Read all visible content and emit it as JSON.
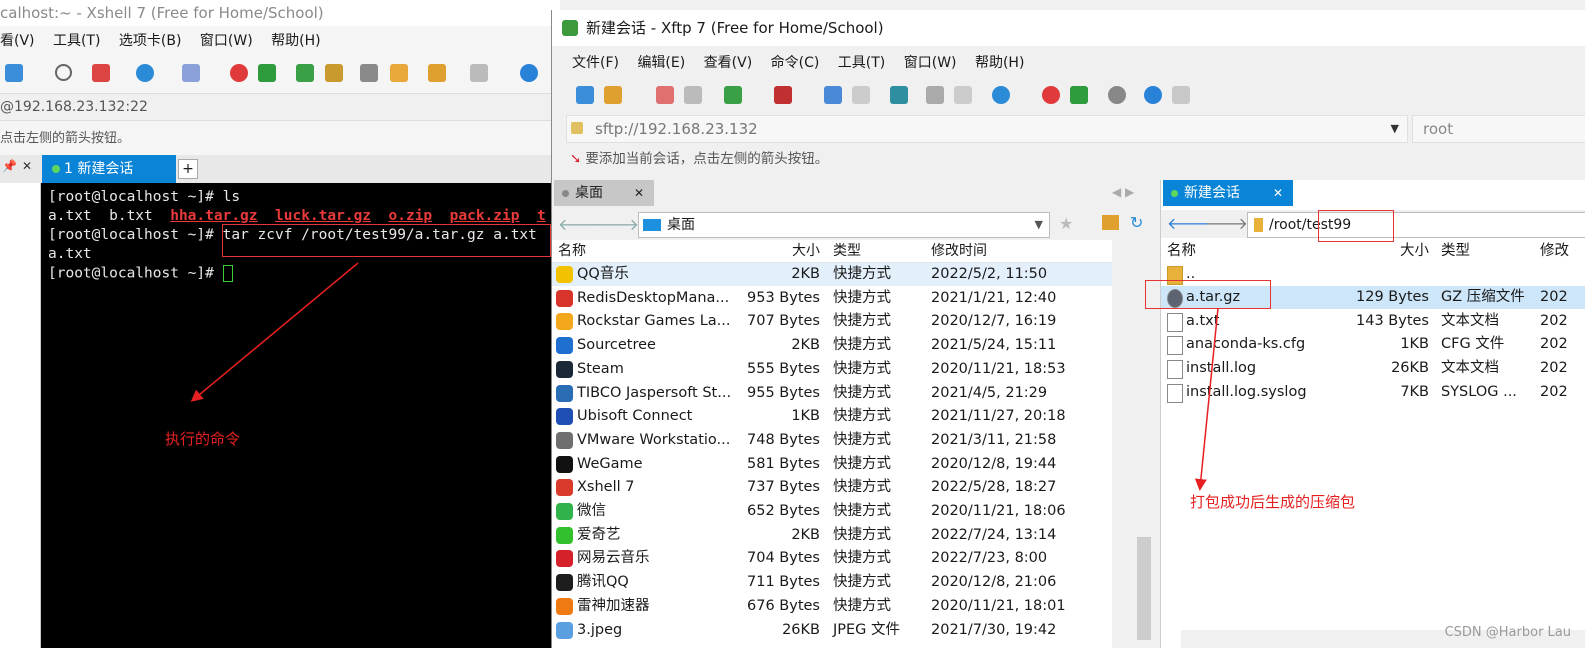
{
  "xshell": {
    "title": "calhost:~ - Xshell 7 (Free for Home/School)",
    "menu": [
      "看(V)",
      "工具(T)",
      "选项卡(B)",
      "窗口(W)",
      "帮助(H)"
    ],
    "address": "@192.168.23.132:22",
    "hint": "点击左侧的箭头按钮。",
    "tab_label": "1 新建会话",
    "tab_plus": "+",
    "terminal": {
      "line1_prompt": "[root@localhost ~]# ",
      "line1_cmd": "ls",
      "line2_plain": "a.txt  b.txt  ",
      "line2_red": [
        "hha.tar.gz",
        "luck.tar.gz",
        "o.zip",
        "pack.zip",
        "t"
      ],
      "line3_prompt": "[root@localhost ~]# ",
      "line3_cmd": "tar zcvf /root/test99/a.tar.gz a.txt",
      "line4": "a.txt",
      "line5_prompt": "[root@localhost ~]# "
    }
  },
  "xftp": {
    "title": "新建会话 - Xftp 7 (Free for Home/School)",
    "menu": [
      "文件(F)",
      "编辑(E)",
      "查看(V)",
      "命令(C)",
      "工具(T)",
      "窗口(W)",
      "帮助(H)"
    ],
    "address": "sftp://192.168.23.132",
    "user": "root",
    "hint": "要添加当前会话，点击左侧的箭头按钮。",
    "left_pane": {
      "tab": "桌面",
      "path": "桌面",
      "headers": {
        "name": "名称",
        "size": "大小",
        "type": "类型",
        "date": "修改时间"
      },
      "rows": [
        {
          "name": "QQ音乐",
          "size": "2KB",
          "type": "快捷方式",
          "date": "2022/5/2, 11:50",
          "icon_color": "#f2c200"
        },
        {
          "name": "RedisDesktopMana...",
          "size": "953 Bytes",
          "type": "快捷方式",
          "date": "2021/1/21, 12:40",
          "icon_color": "#d9342b"
        },
        {
          "name": "Rockstar Games La...",
          "size": "707 Bytes",
          "type": "快捷方式",
          "date": "2020/12/7, 16:19",
          "icon_color": "#f3a81c"
        },
        {
          "name": "Sourcetree",
          "size": "2KB",
          "type": "快捷方式",
          "date": "2021/5/24, 15:11",
          "icon_color": "#1f6fd1"
        },
        {
          "name": "Steam",
          "size": "555 Bytes",
          "type": "快捷方式",
          "date": "2020/11/21, 18:53",
          "icon_color": "#1b2838"
        },
        {
          "name": "TIBCO Jaspersoft St...",
          "size": "955 Bytes",
          "type": "快捷方式",
          "date": "2021/4/5, 21:29",
          "icon_color": "#2a6db5"
        },
        {
          "name": "Ubisoft Connect",
          "size": "1KB",
          "type": "快捷方式",
          "date": "2021/11/27, 20:18",
          "icon_color": "#1f4fb5"
        },
        {
          "name": "VMware Workstatio...",
          "size": "748 Bytes",
          "type": "快捷方式",
          "date": "2021/3/11, 21:58",
          "icon_color": "#6f6f6f"
        },
        {
          "name": "WeGame",
          "size": "581 Bytes",
          "type": "快捷方式",
          "date": "2020/12/8, 19:44",
          "icon_color": "#111111"
        },
        {
          "name": "Xshell 7",
          "size": "737 Bytes",
          "type": "快捷方式",
          "date": "2022/5/28, 18:27",
          "icon_color": "#d93a2b"
        },
        {
          "name": "微信",
          "size": "652 Bytes",
          "type": "快捷方式",
          "date": "2020/11/21, 18:06",
          "icon_color": "#2fb34a"
        },
        {
          "name": "爱奇艺",
          "size": "2KB",
          "type": "快捷方式",
          "date": "2022/7/24, 13:14",
          "icon_color": "#32c12c"
        },
        {
          "name": "网易云音乐",
          "size": "704 Bytes",
          "type": "快捷方式",
          "date": "2022/7/23, 8:00",
          "icon_color": "#d6202a"
        },
        {
          "name": "腾讯QQ",
          "size": "711 Bytes",
          "type": "快捷方式",
          "date": "2020/12/8, 21:06",
          "icon_color": "#1d1d1d"
        },
        {
          "name": "雷神加速器",
          "size": "676 Bytes",
          "type": "快捷方式",
          "date": "2020/11/21, 18:01",
          "icon_color": "#f07a12"
        },
        {
          "name": "3.jpeg",
          "size": "26KB",
          "type": "JPEG 文件",
          "date": "2021/7/30, 19:42",
          "icon_color": "#5aa0e0"
        }
      ]
    },
    "right_pane": {
      "tab": "新建会话",
      "path": "/root/test99",
      "headers": {
        "name": "名称",
        "size": "大小",
        "type": "类型",
        "date": "修改"
      },
      "parent": "..",
      "rows": [
        {
          "name": "a.tar.gz",
          "size": "129 Bytes",
          "type": "GZ 压缩文件",
          "date": "202"
        },
        {
          "name": "a.txt",
          "size": "143 Bytes",
          "type": "文本文档",
          "date": "202"
        },
        {
          "name": "anaconda-ks.cfg",
          "size": "1KB",
          "type": "CFG 文件",
          "date": "202"
        },
        {
          "name": "install.log",
          "size": "26KB",
          "type": "文本文档",
          "date": "202"
        },
        {
          "name": "install.log.syslog",
          "size": "7KB",
          "type": "SYSLOG ...",
          "date": "202"
        }
      ]
    }
  },
  "annotations": {
    "command_note": "执行的命令",
    "archive_note": "打包成功后生成的压缩包"
  },
  "watermark": "CSDN @Harbor Lau"
}
